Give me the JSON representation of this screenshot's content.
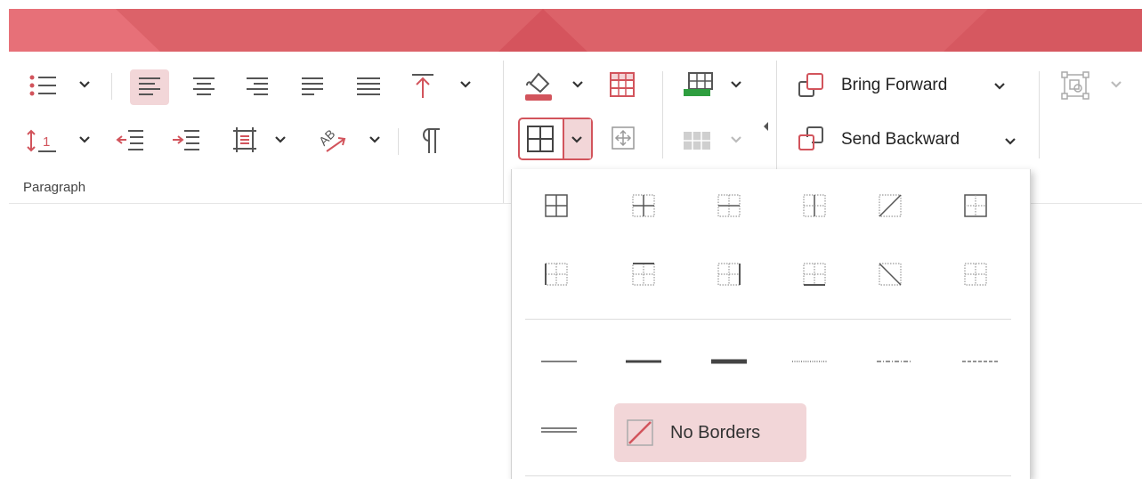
{
  "ribbon": {
    "paragraph_group_label": "Paragraph",
    "bring_forward_label": "Bring Forward",
    "send_backward_label": "Send Backward"
  },
  "borders_menu": {
    "no_borders_label": "No Borders"
  },
  "colors": {
    "accent": "#dc6269",
    "accent_dark": "#c9434c",
    "highlight": "#f2d6d8",
    "fill_green": "#2e9e3f"
  },
  "icons": [
    "bullet-list-icon",
    "align-left-icon",
    "align-center-icon",
    "align-right-icon",
    "justify-icon",
    "distributed-icon",
    "align-top-icon",
    "line-spacing-icon",
    "decrease-indent-icon",
    "increase-indent-icon",
    "text-box-icon",
    "text-direction-icon",
    "pilcrow-icon",
    "shading-icon",
    "table-header-icon",
    "borders-icon",
    "move-table-icon",
    "insert-table-icon",
    "table-style-icon",
    "bring-forward-icon",
    "send-backward-icon",
    "arrange-icon"
  ]
}
